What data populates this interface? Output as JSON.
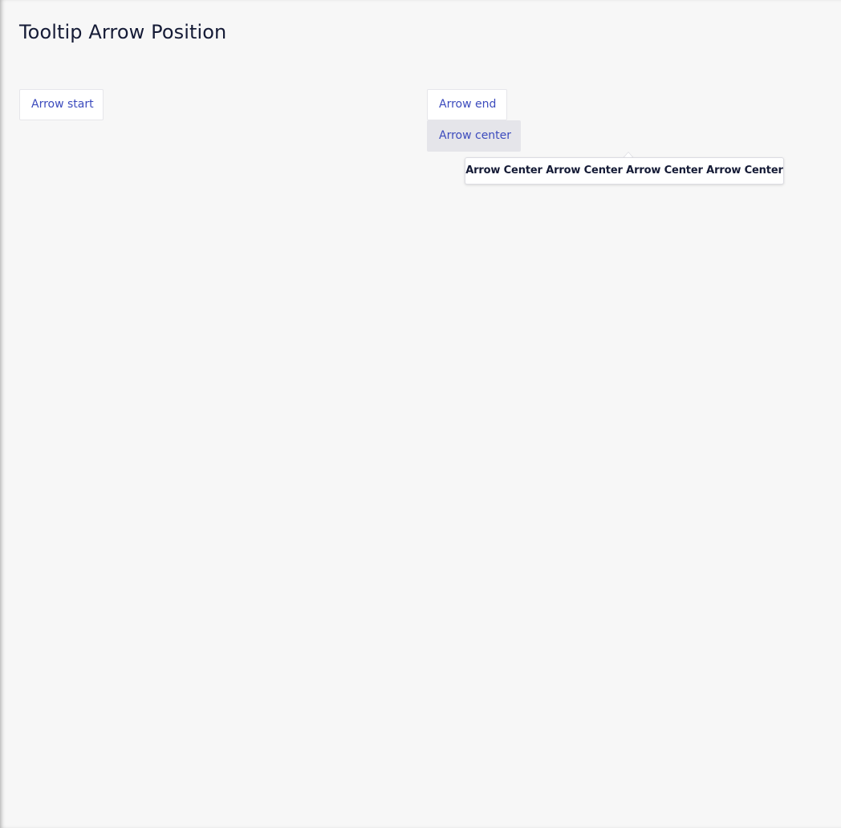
{
  "page": {
    "title": "Tooltip Arrow Position"
  },
  "buttons": {
    "start_label": "Arrow start",
    "end_label": "Arrow end",
    "center_label": "Arrow center"
  },
  "tooltip": {
    "text": "Arrow Center Arrow Center Arrow Center Arrow Center",
    "arrow_position": "center",
    "anchor": "arrow-center-button"
  },
  "colors": {
    "background": "#f7f7f7",
    "title_text": "#151b36",
    "button_text": "#3c4bbd",
    "button_active_bg": "#e5e5ea",
    "tooltip_bg": "#ffffff",
    "tooltip_border": "#dcdce2"
  }
}
